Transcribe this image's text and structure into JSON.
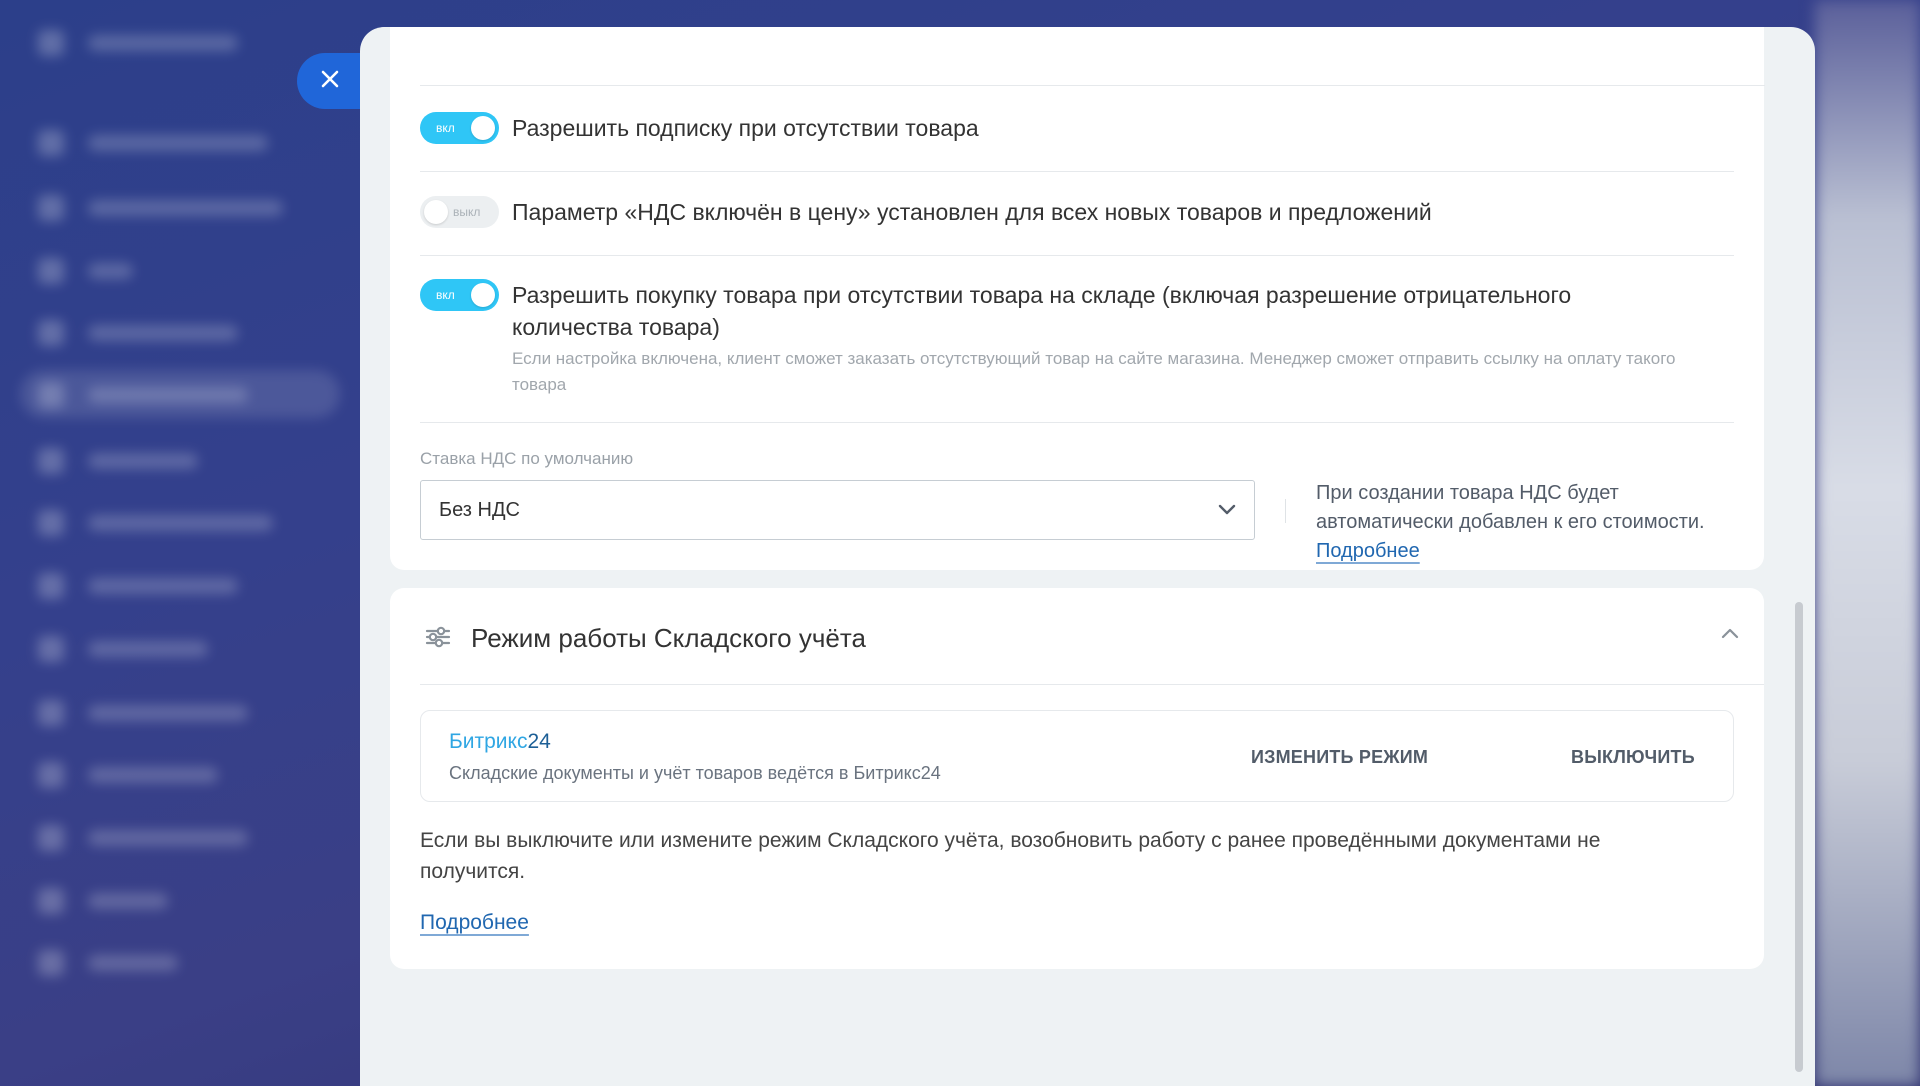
{
  "dialog": {
    "close_icon": "close-icon"
  },
  "settings": {
    "options": [
      {
        "label": "Разрешить подписку при отсутствии товара",
        "enabled": true,
        "toggle_text": "вкл"
      },
      {
        "label": "Параметр «НДС включён в цену» установлен для всех новых товаров и предложений",
        "enabled": false,
        "toggle_text": "выкл"
      },
      {
        "label": "Разрешить покупку товара при отсутствии товара на складе (включая разрешение отрицательного количества товара)",
        "enabled": true,
        "toggle_text": "вкл",
        "hint": "Если настройка включена, клиент сможет заказать отсутствующий товар на сайте магазина. Менеджер сможет отправить ссылку на оплату такого товара"
      }
    ],
    "vat": {
      "label": "Ставка НДС по умолчанию",
      "selected": "Без НДС",
      "note": "При создании товара НДС будет автоматически добавлен к его стоимости.",
      "more_link": "Подробнее"
    }
  },
  "warehouse": {
    "title": "Режим работы Складского учёта",
    "mode": {
      "name_part1": "Битрикс",
      "name_part2": "24",
      "description": "Складские документы и учёт товаров ведётся в Битрикс24",
      "change_button": "ИЗМЕНИТЬ РЕЖИМ",
      "off_button": "ВЫКЛЮЧИТЬ"
    },
    "warning": "Если вы выключите или измените режим Складского учёта, возобновить работу с ранее проведёнными документами не получится.",
    "more_link": "Подробнее"
  },
  "colors": {
    "toggle_on": "#2fc6f6",
    "close_button": "#2066d9",
    "link": "#2067b0",
    "brand_bitrix": "#2fa6e3",
    "brand_24": "#1d5f96"
  }
}
